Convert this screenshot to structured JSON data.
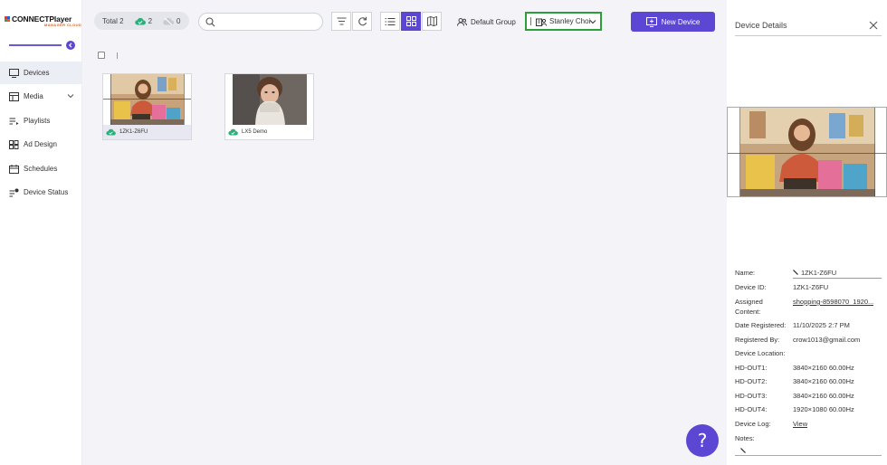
{
  "brand": {
    "name": "CONNECTPlayer",
    "sub": "MANAGER CLOUD",
    "colors": {
      "accent": "#5c46d4",
      "logo_red": "#e23b2e",
      "logo_blue": "#2a62c9",
      "logo_green": "#2ea84b",
      "logo_orange": "#e05d1f",
      "online": "#2cb07a",
      "highlight_border": "#2c9e3a"
    }
  },
  "sidebar": {
    "collapse_icon": "chevron-left-icon",
    "items": [
      {
        "label": "Devices",
        "icon": "monitor-icon",
        "active": true
      },
      {
        "label": "Media",
        "icon": "media-grid-icon",
        "expandable": true
      },
      {
        "label": "Playlists",
        "icon": "playlist-icon"
      },
      {
        "label": "Ad Design",
        "icon": "ad-design-icon"
      },
      {
        "label": "Schedules",
        "icon": "calendar-icon"
      },
      {
        "label": "Device Status",
        "icon": "device-status-icon"
      }
    ]
  },
  "toolbar": {
    "total_label": "Total 2",
    "online_count": "2",
    "offline_count": "0",
    "search_placeholder": "",
    "group_label": "Default Group",
    "user_label": "Stanley Choi",
    "new_device_label": "New Device",
    "view_mode": "grid"
  },
  "devices": [
    {
      "name": "1ZK1-Z6FU",
      "status": "online",
      "selected": true
    },
    {
      "name": "LX5 Demo",
      "status": "online",
      "selected": false
    }
  ],
  "details": {
    "title": "Device Details",
    "fields": [
      {
        "label": "Name:",
        "value": "1ZK1-Z6FU",
        "edit_icon": true
      },
      {
        "label": "Device ID:",
        "value": "1ZK1-Z6FU"
      },
      {
        "label": "Assigned Content:",
        "value": "shopping-8598070_1920..."
      },
      {
        "label": "Date Registered:",
        "value": "11/10/2025 2:7 PM"
      },
      {
        "label": "Registered By:",
        "value": "crow1013@gmail.com"
      },
      {
        "label": "Device Location:",
        "value": ""
      },
      {
        "label": "HD-OUT1:",
        "value": "3840×2160 60.00Hz"
      },
      {
        "label": "HD-OUT2:",
        "value": "3840×2160 60.00Hz"
      },
      {
        "label": "HD-OUT3:",
        "value": "3840×2160 60.00Hz"
      },
      {
        "label": "HD-OUT4:",
        "value": "1920×1080 60.00Hz"
      },
      {
        "label": "Device Log:",
        "value": "View"
      },
      {
        "label": "Notes:",
        "value": ""
      }
    ]
  },
  "help_label": "?"
}
